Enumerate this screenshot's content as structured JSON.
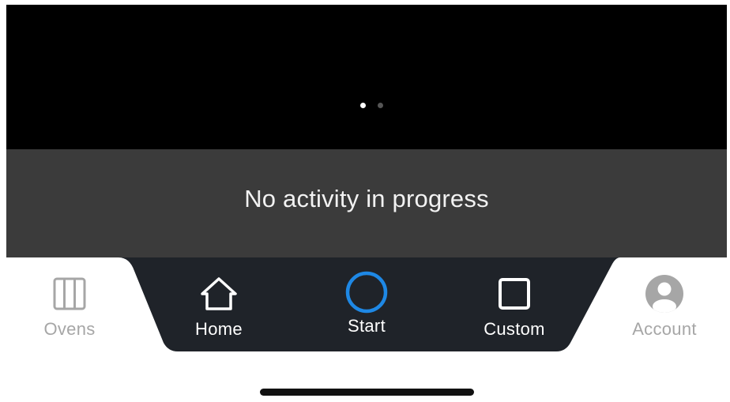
{
  "carousel": {
    "pages": 2,
    "active_page": 1
  },
  "activity": {
    "status_text": "No activity in progress"
  },
  "nav": {
    "items": [
      {
        "label": "Ovens",
        "icon": "ovens-grid-icon",
        "active": false
      },
      {
        "label": "Home",
        "icon": "home-icon",
        "active": false
      },
      {
        "label": "Start",
        "icon": "start-circle-icon",
        "active": true
      },
      {
        "label": "Custom",
        "icon": "custom-square-icon",
        "active": false
      },
      {
        "label": "Account",
        "icon": "account-icon",
        "active": false
      }
    ]
  },
  "colors": {
    "carousel_bg": "#000000",
    "activity_bg": "#3b3b3b",
    "nav_center_bg": "#1f2329",
    "accent": "#1e88e5",
    "inactive": "#a6a6a6"
  }
}
